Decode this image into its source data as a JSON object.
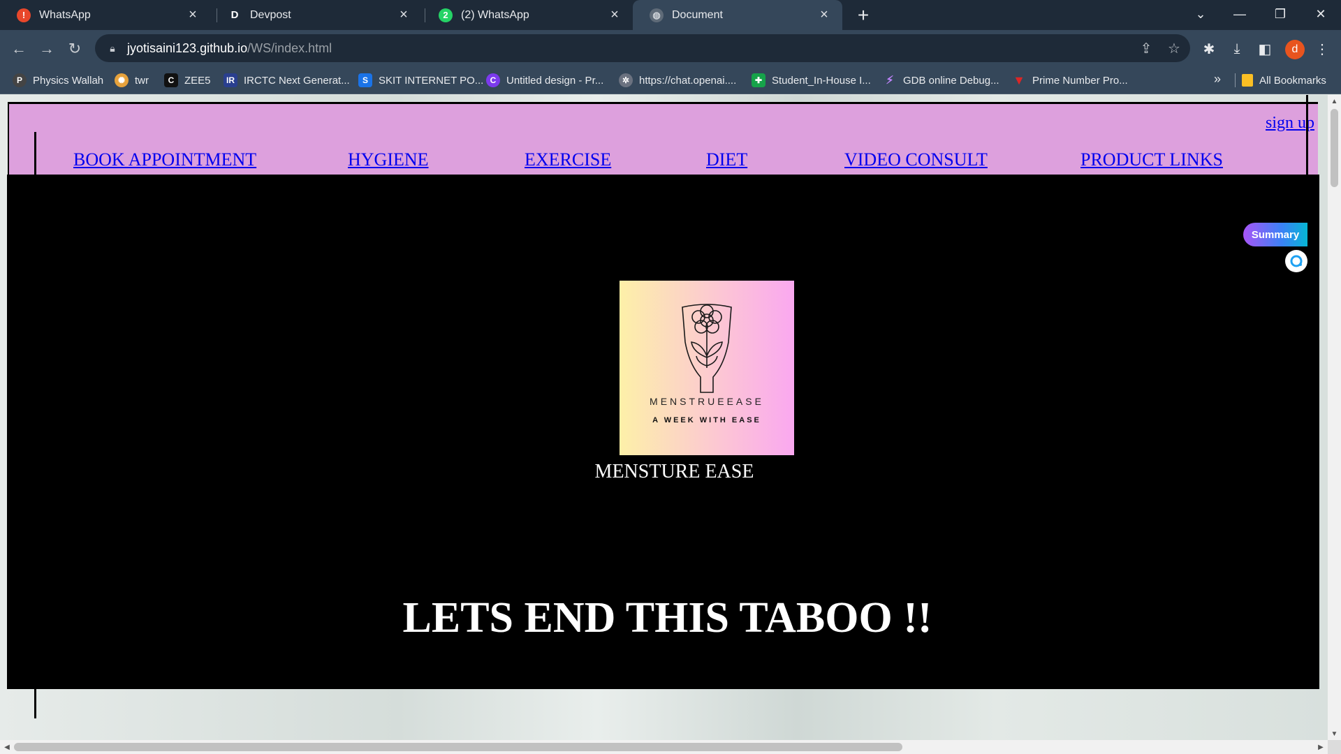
{
  "browser": {
    "tabs": [
      {
        "label": "WhatsApp",
        "icon": "alert-icon",
        "active": false
      },
      {
        "label": "Devpost",
        "icon": "devpost-icon",
        "active": false
      },
      {
        "label": "(2) WhatsApp",
        "icon": "whatsapp-icon",
        "active": false
      },
      {
        "label": "Document",
        "icon": "globe-icon",
        "active": true
      }
    ],
    "address": {
      "host": "jyotisaini123.github.io",
      "path": "/WS/index.html"
    },
    "profile_initial": "d",
    "bookmarks": [
      {
        "label": "Physics Wallah"
      },
      {
        "label": "twr"
      },
      {
        "label": "ZEE5"
      },
      {
        "label": "IRCTC Next Generat..."
      },
      {
        "label": "SKIT INTERNET PO..."
      },
      {
        "label": "Untitled design - Pr..."
      },
      {
        "label": "https://chat.openai...."
      },
      {
        "label": "Student_In-House I..."
      },
      {
        "label": "GDB online Debug..."
      },
      {
        "label": "Prime Number Pro..."
      }
    ],
    "all_bookmarks_label": "All Bookmarks"
  },
  "site": {
    "signup": "sign up",
    "nav": [
      {
        "label": "BOOK APPOINTMENT"
      },
      {
        "label": "HYGIENE"
      },
      {
        "label": "EXERCISE"
      },
      {
        "label": "DIET"
      },
      {
        "label": "VIDEO CONSULT"
      },
      {
        "label": "PRODUCT LINKS"
      }
    ],
    "logo_wordmark": "MENSTRUEEASE",
    "logo_tagline": "A WEEK WITH EASE",
    "brand_name": "MENSTURE EASE",
    "headline": "LETS END THIS TABOO !!"
  },
  "extension": {
    "summary_label": "Summary"
  },
  "colors": {
    "header_bg": "#dda0dd",
    "link": "#0000ee",
    "hero_bg": "#000000",
    "tab_strip": "#1e2a38",
    "toolbar": "#35475a"
  }
}
